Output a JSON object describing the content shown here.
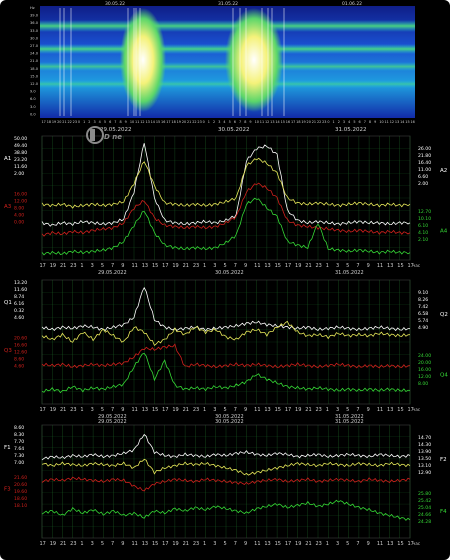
{
  "colors": {
    "bg": "#000000",
    "grid": "#1f6b2a",
    "frame": "#2f2f2f",
    "white": "#ffffff",
    "yellow": "#e8e85a",
    "red": "#d0201c",
    "green": "#35d835",
    "axis_text": "#cfcfcf"
  },
  "spectrogram": {
    "top_dates": [
      "30.05.22",
      "31.05.22",
      "01.06.22"
    ],
    "y_labels": [
      "Hz",
      "39.0",
      "36.0",
      "33.0",
      "30.0",
      "27.0",
      "24.0",
      "21.0",
      "18.0",
      "15.0",
      "12.0",
      "9.0",
      "6.0",
      "3.0",
      "0.0"
    ]
  },
  "date_labels": [
    "29.05.2022",
    "30.05.2022",
    "31.05.2022"
  ],
  "x_hours": [
    "17",
    "19",
    "21",
    "23",
    "1",
    "3",
    "5",
    "7",
    "9",
    "11",
    "13",
    "15",
    "17",
    "19",
    "21",
    "23",
    "1",
    "3",
    "5",
    "7",
    "9",
    "11",
    "13",
    "15",
    "17",
    "19",
    "21",
    "23",
    "1",
    "3",
    "5",
    "7",
    "9",
    "11",
    "13",
    "15",
    "17"
  ],
  "x_unit": "час",
  "logo_text": "D news",
  "chart_data": [
    {
      "type": "line",
      "panel": "A",
      "x": [
        0,
        1,
        2,
        3,
        4,
        5,
        6,
        7,
        8,
        9,
        10,
        11,
        12,
        13,
        14,
        15,
        16,
        17,
        18,
        19,
        20,
        21,
        22,
        23,
        24,
        25,
        26,
        27,
        28,
        29,
        30,
        31,
        32,
        33,
        34,
        35,
        36
      ],
      "left_labels": [
        "A1",
        "A3"
      ],
      "right_labels": [
        "A2",
        "A4"
      ],
      "left_ticks_top": [
        "50.00",
        "49.40",
        "38.80",
        "23.20",
        "11.60",
        "2.00"
      ],
      "left_ticks_red": [
        "16.00",
        "12.00",
        "8.00",
        "4.00",
        "0.00"
      ],
      "right_ticks_top": [
        "26.00",
        "21.80",
        "16.40",
        "11.00",
        "6.60",
        "2.00"
      ],
      "right_ticks_green": [
        "12.70",
        "10.10",
        "6.10",
        "4.10",
        "2.10"
      ],
      "series": [
        {
          "name": "A1",
          "color": "white",
          "values": [
            0.3,
            0.28,
            0.3,
            0.29,
            0.31,
            0.3,
            0.29,
            0.3,
            0.33,
            0.55,
            0.95,
            0.5,
            0.32,
            0.3,
            0.29,
            0.3,
            0.31,
            0.3,
            0.32,
            0.36,
            0.8,
            0.9,
            0.92,
            0.85,
            0.4,
            0.32,
            0.3,
            0.31,
            0.3,
            0.29,
            0.3,
            0.31,
            0.3,
            0.3,
            0.29,
            0.3,
            0.3
          ]
        },
        {
          "name": "A2",
          "color": "yellow",
          "values": [
            0.45,
            0.44,
            0.45,
            0.43,
            0.44,
            0.45,
            0.44,
            0.45,
            0.47,
            0.62,
            0.8,
            0.6,
            0.46,
            0.45,
            0.44,
            0.45,
            0.44,
            0.45,
            0.47,
            0.5,
            0.76,
            0.82,
            0.78,
            0.7,
            0.5,
            0.46,
            0.45,
            0.46,
            0.45,
            0.44,
            0.45,
            0.46,
            0.45,
            0.44,
            0.45,
            0.44,
            0.45
          ]
        },
        {
          "name": "A3",
          "color": "red",
          "values": [
            0.2,
            0.22,
            0.21,
            0.23,
            0.22,
            0.24,
            0.25,
            0.26,
            0.3,
            0.42,
            0.48,
            0.34,
            0.28,
            0.27,
            0.26,
            0.27,
            0.26,
            0.27,
            0.3,
            0.35,
            0.55,
            0.62,
            0.58,
            0.5,
            0.32,
            0.28,
            0.27,
            0.26,
            0.25,
            0.24,
            0.23,
            0.24,
            0.23,
            0.22,
            0.23,
            0.22,
            0.22
          ]
        },
        {
          "name": "A4",
          "color": "green",
          "values": [
            0.05,
            0.06,
            0.05,
            0.07,
            0.06,
            0.07,
            0.08,
            0.1,
            0.15,
            0.28,
            0.4,
            0.22,
            0.12,
            0.1,
            0.09,
            0.1,
            0.09,
            0.1,
            0.14,
            0.2,
            0.45,
            0.5,
            0.42,
            0.35,
            0.15,
            0.12,
            0.1,
            0.3,
            0.09,
            0.08,
            0.07,
            0.08,
            0.07,
            0.06,
            0.07,
            0.06,
            0.06
          ]
        }
      ]
    },
    {
      "type": "line",
      "panel": "Q",
      "x": [
        0,
        1,
        2,
        3,
        4,
        5,
        6,
        7,
        8,
        9,
        10,
        11,
        12,
        13,
        14,
        15,
        16,
        17,
        18,
        19,
        20,
        21,
        22,
        23,
        24,
        25,
        26,
        27,
        28,
        29,
        30,
        31,
        32,
        33,
        34,
        35,
        36
      ],
      "left_labels": [
        "Q1",
        "Q3"
      ],
      "right_labels": [
        "Q2",
        "Q4"
      ],
      "left_ticks_top": [
        "13.20",
        "11.60",
        "8.74",
        "6.16",
        "0.32",
        "4.60"
      ],
      "left_ticks_red": [
        "20.60",
        "16.60",
        "12.60",
        "8.60",
        "4.60"
      ],
      "right_ticks_top": [
        "9.10",
        "8.26",
        "7.42",
        "6.58",
        "5.74",
        "4.90"
      ],
      "right_ticks_green": [
        "24.00",
        "20.00",
        "16.00",
        "12.00",
        "8.00"
      ],
      "series": [
        {
          "name": "Q1",
          "color": "white",
          "values": [
            0.62,
            0.6,
            0.62,
            0.61,
            0.63,
            0.62,
            0.6,
            0.62,
            0.64,
            0.7,
            0.95,
            0.68,
            0.62,
            0.6,
            0.61,
            0.62,
            0.6,
            0.61,
            0.62,
            0.63,
            0.65,
            0.66,
            0.64,
            0.63,
            0.62,
            0.61,
            0.62,
            0.6,
            0.61,
            0.62,
            0.61,
            0.6,
            0.61,
            0.62,
            0.61,
            0.6,
            0.61
          ]
        },
        {
          "name": "Q2",
          "color": "yellow",
          "values": [
            0.55,
            0.52,
            0.56,
            0.5,
            0.58,
            0.52,
            0.6,
            0.55,
            0.5,
            0.62,
            0.58,
            0.48,
            0.52,
            0.6,
            0.56,
            0.62,
            0.58,
            0.6,
            0.54,
            0.52,
            0.58,
            0.6,
            0.56,
            0.62,
            0.66,
            0.58,
            0.55,
            0.56,
            0.54,
            0.57,
            0.55,
            0.56,
            0.55,
            0.57,
            0.56,
            0.55,
            0.56
          ]
        },
        {
          "name": "Q3",
          "color": "red",
          "values": [
            0.32,
            0.31,
            0.32,
            0.3,
            0.31,
            0.32,
            0.31,
            0.32,
            0.33,
            0.38,
            0.45,
            0.44,
            0.46,
            0.47,
            0.3,
            0.32,
            0.31,
            0.3,
            0.31,
            0.32,
            0.31,
            0.32,
            0.31,
            0.3,
            0.31,
            0.32,
            0.31,
            0.3,
            0.31,
            0.32,
            0.31,
            0.3,
            0.31,
            0.3,
            0.31,
            0.3,
            0.31
          ]
        },
        {
          "name": "Q4",
          "color": "green",
          "values": [
            0.1,
            0.12,
            0.1,
            0.14,
            0.11,
            0.13,
            0.12,
            0.14,
            0.16,
            0.3,
            0.42,
            0.2,
            0.35,
            0.15,
            0.12,
            0.13,
            0.12,
            0.14,
            0.13,
            0.15,
            0.18,
            0.24,
            0.2,
            0.17,
            0.14,
            0.13,
            0.12,
            0.13,
            0.12,
            0.11,
            0.12,
            0.11,
            0.12,
            0.11,
            0.12,
            0.11,
            0.11
          ]
        }
      ]
    },
    {
      "type": "line",
      "panel": "F",
      "x": [
        0,
        1,
        2,
        3,
        4,
        5,
        6,
        7,
        8,
        9,
        10,
        11,
        12,
        13,
        14,
        15,
        16,
        17,
        18,
        19,
        20,
        21,
        22,
        23,
        24,
        25,
        26,
        27,
        28,
        29,
        30,
        31,
        32,
        33,
        34,
        35,
        36
      ],
      "left_labels": [
        "F1",
        "F3"
      ],
      "right_labels": [
        "F2",
        "F4"
      ],
      "left_ticks_top": [
        "8.60",
        "8.30",
        "7.70",
        "7.64",
        "7.30",
        "7.00"
      ],
      "left_ticks_red": [
        "21.60",
        "20.60",
        "19.60",
        "18.60",
        "18.10"
      ],
      "right_ticks_top": [
        "14.70",
        "14.30",
        "13.90",
        "13.50",
        "13.10",
        "12.90"
      ],
      "right_ticks_green": [
        "25.80",
        "25.42",
        "25.04",
        "24.66",
        "24.28"
      ],
      "series": [
        {
          "name": "F1",
          "color": "white",
          "values": [
            0.7,
            0.72,
            0.71,
            0.73,
            0.72,
            0.74,
            0.72,
            0.73,
            0.75,
            0.78,
            0.92,
            0.76,
            0.73,
            0.72,
            0.74,
            0.73,
            0.72,
            0.74,
            0.73,
            0.75,
            0.76,
            0.74,
            0.73,
            0.75,
            0.74,
            0.72,
            0.73,
            0.74,
            0.72,
            0.73,
            0.74,
            0.73,
            0.72,
            0.74,
            0.73,
            0.72,
            0.73
          ]
        },
        {
          "name": "F2",
          "color": "yellow",
          "values": [
            0.66,
            0.64,
            0.66,
            0.65,
            0.64,
            0.66,
            0.65,
            0.64,
            0.66,
            0.62,
            0.7,
            0.58,
            0.62,
            0.64,
            0.66,
            0.65,
            0.66,
            0.64,
            0.62,
            0.6,
            0.56,
            0.58,
            0.6,
            0.62,
            0.64,
            0.66,
            0.65,
            0.64,
            0.66,
            0.65,
            0.64,
            0.66,
            0.65,
            0.64,
            0.66,
            0.65,
            0.64
          ]
        },
        {
          "name": "F3",
          "color": "red",
          "values": [
            0.5,
            0.52,
            0.51,
            0.53,
            0.52,
            0.51,
            0.5,
            0.52,
            0.51,
            0.46,
            0.42,
            0.48,
            0.5,
            0.52,
            0.51,
            0.5,
            0.52,
            0.51,
            0.5,
            0.49,
            0.48,
            0.5,
            0.51,
            0.52,
            0.5,
            0.51,
            0.52,
            0.5,
            0.51,
            0.52,
            0.51,
            0.5,
            0.52,
            0.51,
            0.5,
            0.51,
            0.52
          ]
        },
        {
          "name": "F4",
          "color": "green",
          "values": [
            0.22,
            0.24,
            0.2,
            0.26,
            0.22,
            0.25,
            0.21,
            0.24,
            0.2,
            0.22,
            0.18,
            0.24,
            0.22,
            0.26,
            0.24,
            0.27,
            0.25,
            0.28,
            0.26,
            0.24,
            0.22,
            0.26,
            0.28,
            0.3,
            0.27,
            0.29,
            0.31,
            0.28,
            0.3,
            0.33,
            0.3,
            0.27,
            0.25,
            0.22,
            0.2,
            0.18,
            0.16
          ]
        }
      ]
    }
  ]
}
